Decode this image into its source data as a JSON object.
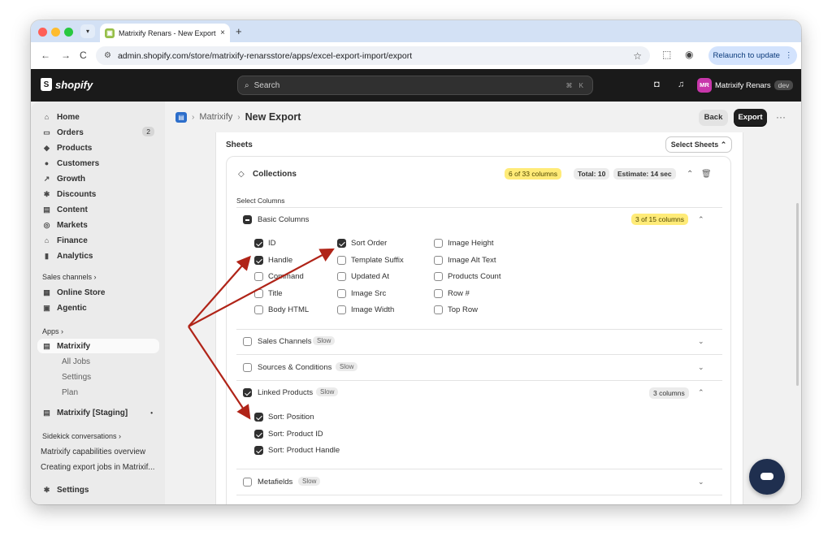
{
  "browser": {
    "tab_title": "Matrixify Renars - New Export",
    "tab_close": "×",
    "new_tab": "+",
    "url": "admin.shopify.com/store/matrixify-renarsstore/apps/excel-export-import/export",
    "relaunch_label": "Relaunch to update",
    "back": "←",
    "forward": "→",
    "reload": "C"
  },
  "topbar": {
    "logo_text": "shopify",
    "search_placeholder": "Search",
    "search_shortcut": "⌘ K",
    "store_initials": "MR",
    "store_name": "Matrixify Renars",
    "store_badge": "dev"
  },
  "sidebar": {
    "items": [
      {
        "label": "Home",
        "icon": "home-icon",
        "glyph": "⌂"
      },
      {
        "label": "Orders",
        "icon": "inbox-icon",
        "glyph": "▭",
        "badge": "2"
      },
      {
        "label": "Products",
        "icon": "tag-icon",
        "glyph": "◆"
      },
      {
        "label": "Customers",
        "icon": "person-icon",
        "glyph": "●"
      },
      {
        "label": "Growth",
        "icon": "growth-icon",
        "glyph": "↗"
      },
      {
        "label": "Discounts",
        "icon": "discount-icon",
        "glyph": "✱"
      },
      {
        "label": "Content",
        "icon": "content-icon",
        "glyph": "▤"
      },
      {
        "label": "Markets",
        "icon": "globe-icon",
        "glyph": "◎"
      },
      {
        "label": "Finance",
        "icon": "bank-icon",
        "glyph": "⌂"
      },
      {
        "label": "Analytics",
        "icon": "bar-chart-icon",
        "glyph": "▮"
      }
    ],
    "sales_channels_heading": "Sales channels ›",
    "channels": [
      {
        "label": "Online Store",
        "icon": "store-icon",
        "glyph": "▦"
      },
      {
        "label": "Agentic",
        "icon": "agentic-icon",
        "glyph": "▣"
      }
    ],
    "apps_heading": "Apps ›",
    "apps": {
      "active": "Matrixify",
      "subitems": [
        "All Jobs",
        "Settings",
        "Plan"
      ],
      "staging": "Matrixify [Staging]"
    },
    "sidekick_heading": "Sidekick conversations ›",
    "conversations": [
      "Matrixify capabilities overview",
      "Creating export jobs in Matrixif..."
    ],
    "settings_label": "Settings"
  },
  "page": {
    "breadcrumb_app": "Matrixify",
    "breadcrumb_sep": "›",
    "title": "New Export",
    "back_label": "Back",
    "export_label": "Export",
    "more": "···"
  },
  "sheets": {
    "heading": "Sheets",
    "select_label": "Select Sheets ⌃",
    "collection": {
      "title": "Collections",
      "columns_count": "6 of 33 columns",
      "total": "Total: 10",
      "estimate": "Estimate: 14 sec",
      "select_columns": "Select Columns"
    },
    "basic_columns": {
      "label": "Basic Columns",
      "count": "3 of 15 columns",
      "col1": [
        {
          "label": "ID",
          "checked": true
        },
        {
          "label": "Handle",
          "checked": true
        },
        {
          "label": "Command",
          "checked": false
        },
        {
          "label": "Title",
          "checked": false
        },
        {
          "label": "Body HTML",
          "checked": false
        }
      ],
      "col2": [
        {
          "label": "Sort Order",
          "checked": true
        },
        {
          "label": "Template Suffix",
          "checked": false
        },
        {
          "label": "Updated At",
          "checked": false
        },
        {
          "label": "Image Src",
          "checked": false
        },
        {
          "label": "Image Width",
          "checked": false
        }
      ],
      "col3": [
        {
          "label": "Image Height",
          "checked": false
        },
        {
          "label": "Image Alt Text",
          "checked": false
        },
        {
          "label": "Products Count",
          "checked": false
        },
        {
          "label": "Row #",
          "checked": false
        },
        {
          "label": "Top Row",
          "checked": false
        }
      ]
    },
    "groups": {
      "sales_channels": "Sales Channels",
      "sources": "Sources & Conditions",
      "linked_products": "Linked Products",
      "linked_count": "3 columns",
      "metafields": "Metafields",
      "slow": "Slow"
    },
    "linked_items": [
      "Sort: Position",
      "Sort: Product ID",
      "Sort: Product Handle"
    ]
  },
  "colors": {
    "annotation_arrow": "#b02418",
    "highlight_pill": "#ffeb78"
  }
}
